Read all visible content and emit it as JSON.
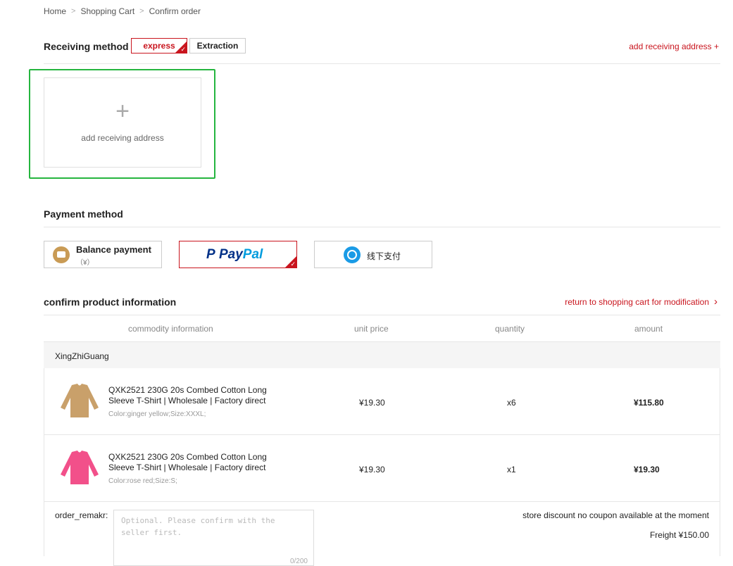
{
  "breadcrumb": {
    "home": "Home",
    "cart": "Shopping Cart",
    "current": "Confirm order",
    "separator": ">"
  },
  "receiving": {
    "title": "Receiving method",
    "tabs": [
      {
        "label": "express",
        "selected": true
      },
      {
        "label": "Extraction",
        "selected": false
      }
    ],
    "add_link": "add receiving address +",
    "card_plus": "+",
    "card_label": "add receiving address"
  },
  "payment": {
    "title": "Payment method",
    "balance_label": "Balance payment",
    "balance_sub": "（¥）",
    "paypal": {
      "p": "P",
      "pay": "Pay",
      "pal": "Pal"
    },
    "offline_label": "线下支付"
  },
  "product": {
    "title": "confirm product information",
    "return_link": "return to shopping cart for modification",
    "return_chevron": "›",
    "columns": {
      "info": "commodity information",
      "price": "unit price",
      "qty": "quantity",
      "amount": "amount"
    },
    "store_name": "XingZhiGuang",
    "rows": [
      {
        "name": "QXK2521 230G 20s Combed Cotton Long Sleeve T-Shirt | Wholesale | Factory direct",
        "spec": "Color:ginger yellow;Size:XXXL;",
        "price": "¥19.30",
        "qty": "x6",
        "amount": "¥115.80",
        "color": "#c9a06a"
      },
      {
        "name": "QXK2521 230G 20s Combed Cotton Long Sleeve T-Shirt | Wholesale | Factory direct",
        "spec": "Color:rose red;Size:S;",
        "price": "¥19.30",
        "qty": "x1",
        "amount": "¥19.30",
        "color": "#f2508a"
      }
    ]
  },
  "remark": {
    "label": "order_remakr:",
    "placeholder": "Optional. Please confirm with the seller first.",
    "count": "0/200"
  },
  "summary": {
    "store_discount": "store discount no coupon available at the moment",
    "freight": "Freight ¥150.00"
  },
  "colors": {
    "accent": "#c9151e",
    "highlight": "#25b53f"
  },
  "icons": [
    "chevron-right-icon",
    "checkmark-icon",
    "plus-icon",
    "wallet-icon",
    "paypal-logo",
    "offline-pay-icon",
    "tshirt-image"
  ]
}
